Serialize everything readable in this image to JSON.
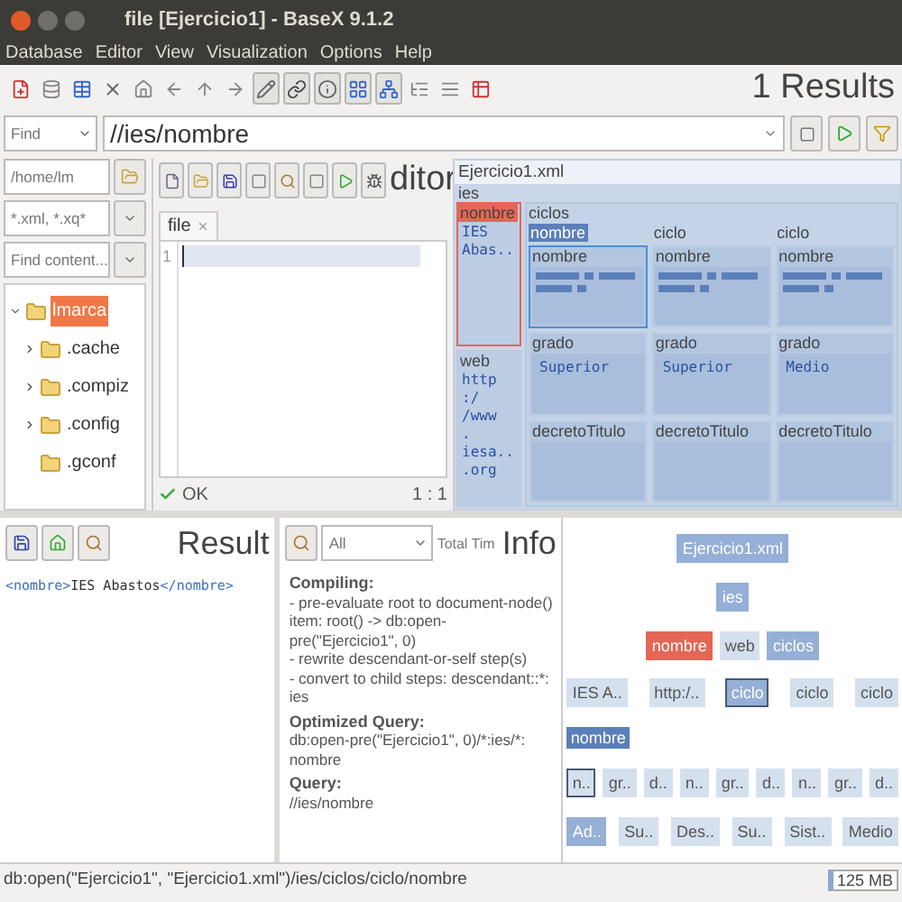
{
  "window": {
    "title": "file [Ejercicio1] - BaseX 9.1.2"
  },
  "menu": [
    "Database",
    "Editor",
    "View",
    "Visualization",
    "Options",
    "Help"
  ],
  "toolbar": {
    "buttons": [
      {
        "selected": false
      },
      {
        "selected": false
      },
      {
        "selected": false
      },
      {
        "selected": false
      },
      {
        "selected": false
      },
      {
        "selected": false
      },
      {
        "selected": false
      },
      {
        "selected": false
      },
      {
        "selected": true
      },
      {
        "selected": true
      },
      {
        "selected": true
      },
      {
        "selected": true
      },
      {
        "selected": true
      },
      {
        "selected": false
      },
      {
        "selected": false
      },
      {
        "selected": false
      }
    ],
    "results": "1 Results"
  },
  "search_bar": {
    "mode": "Find",
    "query": "//ies/nombre"
  },
  "file_browser": {
    "path": "/home/lm",
    "filter": "*.xml, *.xq*",
    "search_placeholder": "Find content...",
    "tree": [
      {
        "name": "lmarca",
        "kind": "branch",
        "expanded": true,
        "selected": true,
        "children": [
          {
            "name": ".cache",
            "kind": "branch",
            "expanded": false,
            "selected": false
          },
          {
            "name": ".compiz",
            "kind": "branch",
            "expanded": false,
            "selected": false
          },
          {
            "name": ".config",
            "kind": "branch",
            "expanded": false,
            "selected": false
          },
          {
            "name": ".gconf",
            "kind": "leaf",
            "expanded": false,
            "selected": false
          }
        ]
      }
    ]
  },
  "editor": {
    "title": "ditor",
    "tab": "file",
    "lines": [
      "1"
    ],
    "status": "OK",
    "position": "1 : 1"
  },
  "map": {
    "file": "Ejercicio1.xml",
    "root": "ies",
    "nombre": {
      "label": "nombre",
      "value": "IES Abas..",
      "selected": true
    },
    "web": {
      "label": "web",
      "value_lines": [
        "http",
        ":/ /www",
        ".",
        "iesa..",
        ".org"
      ]
    },
    "ciclos": {
      "label": "ciclos",
      "items": [
        {
          "label": "nombre",
          "highlighted": true,
          "fields": [
            {
              "label": "nombre",
              "kind": "bars",
              "selected": true
            },
            {
              "label": "grado",
              "kind": "text",
              "value": "Superior",
              "selected": false
            },
            {
              "label": "decretoTitulo",
              "kind": "empty",
              "selected": false
            }
          ]
        },
        {
          "label": "ciclo",
          "highlighted": false,
          "fields": [
            {
              "label": "nombre",
              "kind": "bars",
              "selected": false
            },
            {
              "label": "grado",
              "kind": "text",
              "value": "Superior",
              "selected": false
            },
            {
              "label": "decretoTitulo",
              "kind": "empty",
              "selected": false
            }
          ]
        },
        {
          "label": "ciclo",
          "highlighted": false,
          "fields": [
            {
              "label": "nombre",
              "kind": "bars",
              "selected": false
            },
            {
              "label": "grado",
              "kind": "text",
              "value": "Medio",
              "selected": false
            },
            {
              "label": "decretoTitulo",
              "kind": "empty",
              "selected": false
            }
          ]
        }
      ]
    }
  },
  "result": {
    "title": "Result",
    "content": [
      {
        "kind": "tag",
        "text": "<nombre>"
      },
      {
        "kind": "text",
        "text": "IES Abastos"
      },
      {
        "kind": "tag",
        "text": "</nombre>"
      }
    ]
  },
  "info": {
    "title": "Info",
    "filter": "All",
    "timing_label": "Total Tim",
    "sections": [
      {
        "heading": "Compiling:",
        "lines": [
          "- pre-evaluate root to document-node()",
          "item: root() -> db:open-pre(\"Ejercicio1\", 0)",
          "- rewrite descendant-or-self step(s)",
          "- convert to child steps: descendant::*: ies"
        ]
      },
      {
        "heading": "Optimized Query:",
        "lines": [
          "db:open-pre(\"Ejercicio1\", 0)/*:ies/*: nombre"
        ]
      },
      {
        "heading": "Query:",
        "lines": [
          "//ies/nombre"
        ]
      }
    ]
  },
  "tree": {
    "hover_label": "nombre",
    "levels": [
      [
        {
          "label": "Ejercicio1.xml",
          "highlighted": true,
          "selected": false,
          "focused": false
        }
      ],
      [
        {
          "label": "ies",
          "highlighted": true,
          "selected": false,
          "focused": false
        }
      ],
      [
        {
          "label": "nombre",
          "highlighted": false,
          "selected": true,
          "focused": false
        },
        {
          "label": "web",
          "highlighted": false,
          "selected": false,
          "focused": false
        },
        {
          "label": "ciclos",
          "highlighted": true,
          "selected": false,
          "focused": false
        }
      ],
      [
        {
          "label": "IES A..",
          "highlighted": false,
          "selected": false,
          "focused": false
        },
        {
          "label": "http:/..",
          "highlighted": false,
          "selected": false,
          "focused": false
        },
        {
          "label": "ciclo",
          "highlighted": true,
          "selected": false,
          "focused": true
        },
        {
          "label": "ciclo",
          "highlighted": false,
          "selected": false,
          "focused": false
        },
        {
          "label": "ciclo",
          "highlighted": false,
          "selected": false,
          "focused": false
        }
      ],
      [
        {
          "label": "n..",
          "highlighted": false,
          "selected": false,
          "focused": true
        },
        {
          "label": "gr..",
          "highlighted": false,
          "selected": false,
          "focused": false
        },
        {
          "label": "d..",
          "highlighted": false,
          "selected": false,
          "focused": false
        },
        {
          "label": "n..",
          "highlighted": false,
          "selected": false,
          "focused": false
        },
        {
          "label": "gr..",
          "highlighted": false,
          "selected": false,
          "focused": false
        },
        {
          "label": "d..",
          "highlighted": false,
          "selected": false,
          "focused": false
        },
        {
          "label": "n..",
          "highlighted": false,
          "selected": false,
          "focused": false
        },
        {
          "label": "gr..",
          "highlighted": false,
          "selected": false,
          "focused": false
        },
        {
          "label": "d..",
          "highlighted": false,
          "selected": false,
          "focused": false
        }
      ],
      [
        {
          "label": "Ad..",
          "highlighted": true,
          "selected": false,
          "focused": false
        },
        {
          "label": "Su..",
          "highlighted": false,
          "selected": false,
          "focused": false
        },
        {
          "label": "Des..",
          "highlighted": false,
          "selected": false,
          "focused": false
        },
        {
          "label": "Su..",
          "highlighted": false,
          "selected": false,
          "focused": false
        },
        {
          "label": "Sist..",
          "highlighted": false,
          "selected": false,
          "focused": false
        },
        {
          "label": "Medio",
          "highlighted": false,
          "selected": false,
          "focused": false
        }
      ]
    ]
  },
  "status_bar": {
    "path": "db:open(\"Ejercicio1\", \"Ejercicio1.xml\")/ies/ciclos/ciclo/nombre",
    "memory": "125 MB"
  }
}
